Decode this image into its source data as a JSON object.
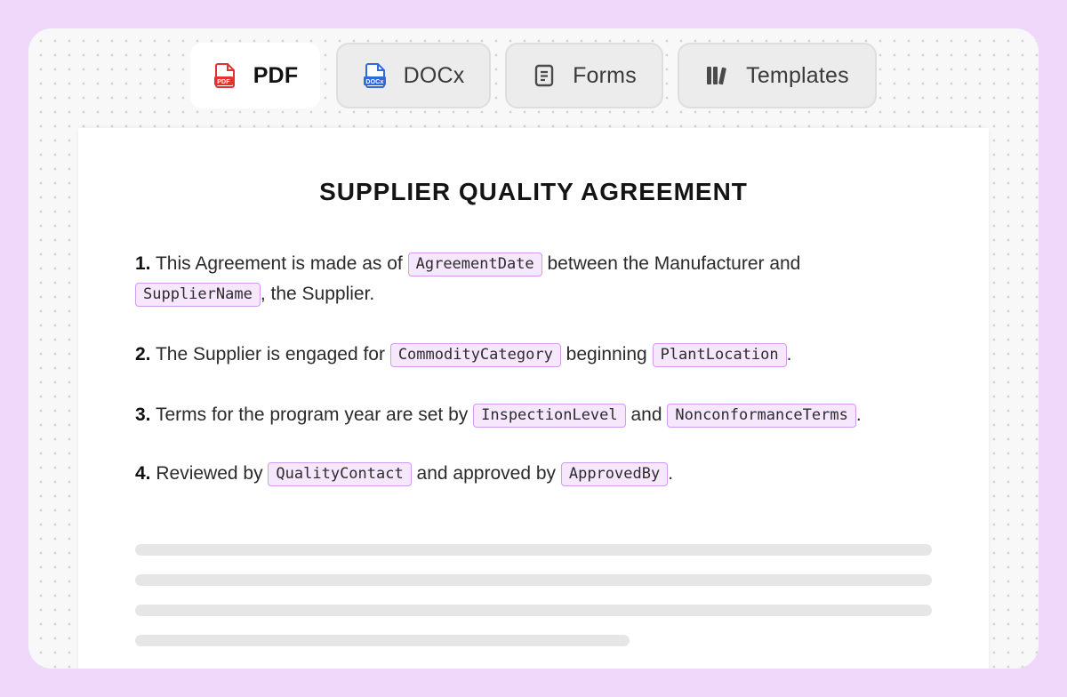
{
  "tabs": [
    {
      "label": "PDF",
      "icon": "pdf-file-icon",
      "active": true
    },
    {
      "label": "DOCx",
      "icon": "docx-file-icon",
      "active": false
    },
    {
      "label": "Forms",
      "icon": "form-document-icon",
      "active": false
    },
    {
      "label": "Templates",
      "icon": "templates-library-icon",
      "active": false
    }
  ],
  "icon_text": {
    "pdf": "PDF",
    "docx": "DOCx"
  },
  "colors": {
    "accent": "#f0d8fb",
    "chip_bg": "#f6e7fd",
    "chip_border": "#cf9cef",
    "pdf_red": "#e2342f",
    "docx_blue": "#2f6bd9"
  },
  "document": {
    "title": "SUPPLIER QUALITY AGREEMENT",
    "paragraphs": [
      {
        "num": "1.",
        "t1": " This Agreement is made as of ",
        "f1": "AgreementDate",
        "t2": " between the Manufacturer and ",
        "f2": "SupplierName",
        "t3": ", the Supplier."
      },
      {
        "num": "2.",
        "t1": " The Supplier is engaged for ",
        "f1": "CommodityCategory",
        "t2": " beginning ",
        "f2": "PlantLocation",
        "t3": "."
      },
      {
        "num": "3.",
        "t1": " Terms for the program year are set by ",
        "f1": "InspectionLevel",
        "t2": " and ",
        "f2": "NonconformanceTerms",
        "t3": "."
      },
      {
        "num": "4.",
        "t1": " Reviewed by ",
        "f1": "QualityContact",
        "t2": " and approved by ",
        "f2": "ApprovedBy",
        "t3": "."
      }
    ]
  }
}
